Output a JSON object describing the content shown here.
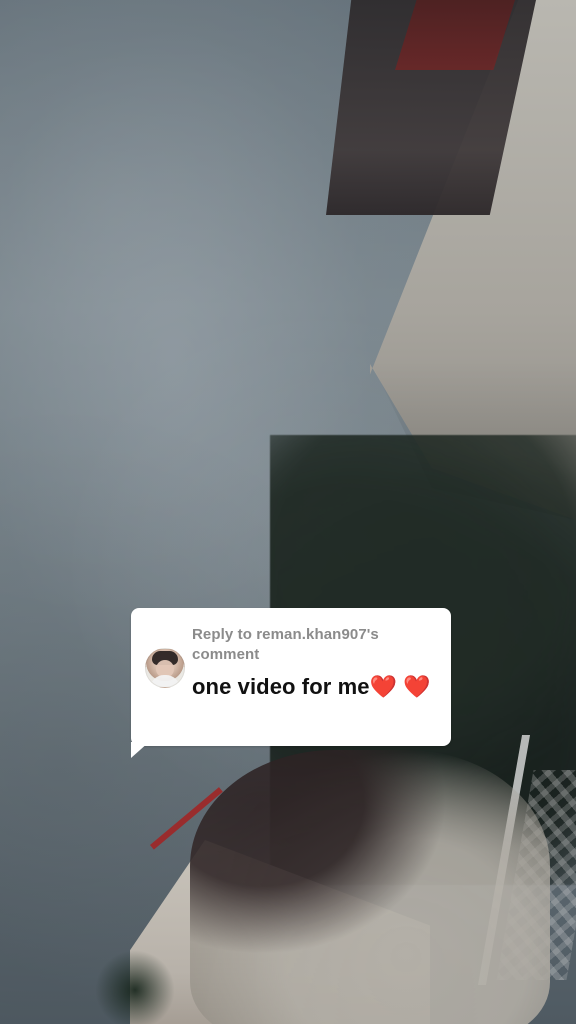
{
  "reply_card": {
    "reply_to_text": "Reply to reman.khan907's comment",
    "comment_text": "one video for me❤️ ❤️"
  }
}
